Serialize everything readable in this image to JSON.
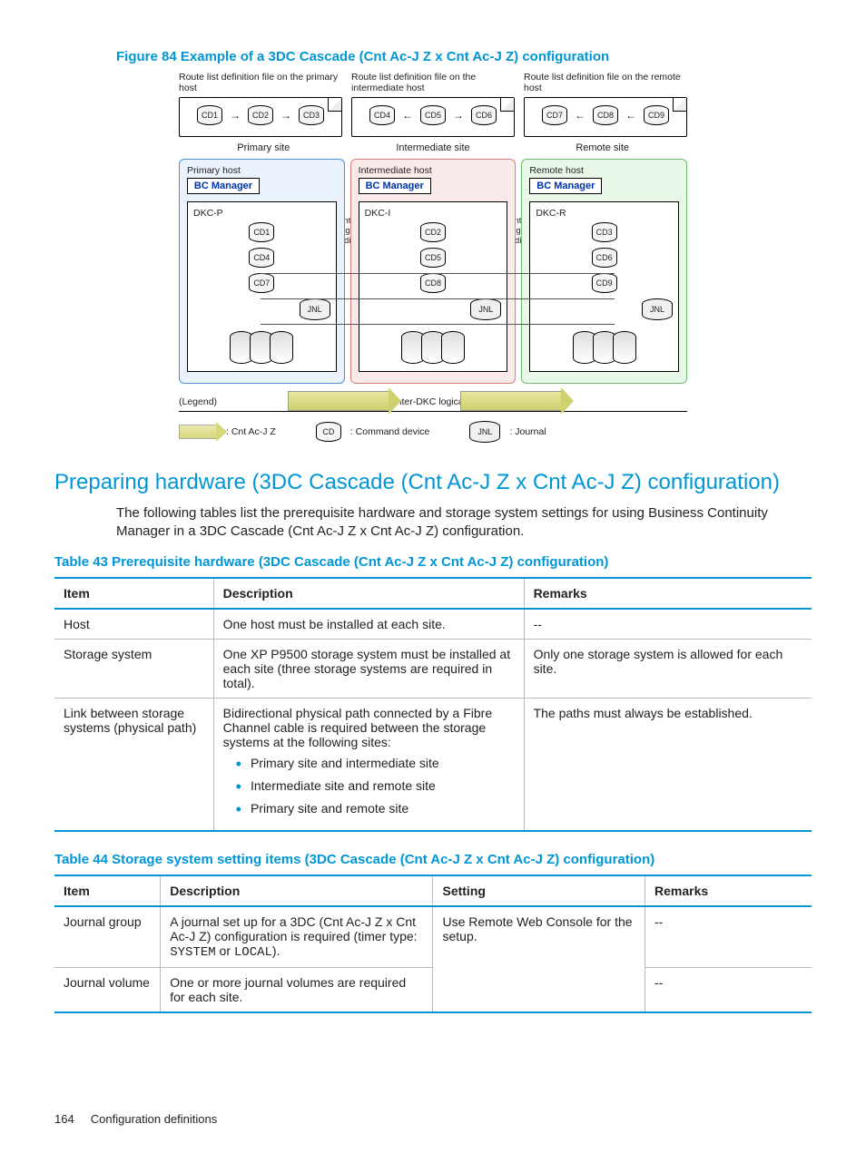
{
  "figure": {
    "title": "Figure 84 Example of a 3DC Cascade (Cnt Ac-J Z x Cnt Ac-J Z) configuration",
    "files": [
      {
        "label": "Route list definition file on the primary host",
        "cds": [
          "CD1",
          "CD2",
          "CD3"
        ],
        "dir": "right"
      },
      {
        "label": "Route list definition file on the intermediate host",
        "cds": [
          "CD4",
          "CD5",
          "CD6"
        ],
        "dir": "left"
      },
      {
        "label": "Route list definition file on the remote host",
        "cds": [
          "CD7",
          "CD8",
          "CD9"
        ],
        "dir": "left"
      }
    ],
    "site_labels": [
      "Primary site",
      "Intermediate site",
      "Remote site"
    ],
    "sites": [
      {
        "host": "Primary host",
        "bc": "BC Manager",
        "dkc": "DKC-P",
        "cds": [
          "CD1",
          "CD4",
          "CD7"
        ],
        "jnl": "JNL"
      },
      {
        "host": "Intermediate host",
        "bc": "BC Manager",
        "dkc": "DKC-I",
        "cds": [
          "CD2",
          "CD5",
          "CD8"
        ],
        "jnl": "JNL"
      },
      {
        "host": "Remote host",
        "bc": "BC Manager",
        "dkc": "DKC-R",
        "cds": [
          "CD3",
          "CD6",
          "CD9"
        ],
        "jnl": "JNL"
      }
    ],
    "inter_dkc_label": "Inter-DKC logical path (bidirectional)",
    "legend_label": "(Legend)",
    "legend_line_text": "Inter-DKC logical path (bidirectional)",
    "legend_items": [
      {
        "label": ": Cnt Ac-J Z"
      },
      {
        "sym": "CD",
        "label": ": Command device"
      },
      {
        "sym": "JNL",
        "label": ": Journal"
      }
    ]
  },
  "section": {
    "title": "Preparing hardware (3DC Cascade (Cnt Ac-J Z x Cnt Ac-J Z) configuration)",
    "body": "The following tables list the prerequisite hardware and storage system settings for using Business Continuity Manager in a 3DC Cascade (Cnt Ac-J Z x Cnt Ac-J Z) configuration."
  },
  "table43": {
    "title": "Table 43 Prerequisite hardware (3DC Cascade (Cnt Ac-J Z x Cnt Ac-J Z) configuration)",
    "headers": [
      "Item",
      "Description",
      "Remarks"
    ],
    "rows": [
      {
        "item": "Host",
        "desc": "One host must be installed at each site.",
        "remarks": "--"
      },
      {
        "item": "Storage system",
        "desc": "One XP P9500 storage system must be installed at each site (three storage systems are required in total).",
        "remarks": "Only one storage system is allowed for each site."
      },
      {
        "item": "Link between storage systems (physical path)",
        "desc": "Bidirectional physical path connected by a Fibre Channel cable is required between the storage systems at the following sites:",
        "bullets": [
          "Primary site and intermediate site",
          "Intermediate site and remote site",
          "Primary site and remote site"
        ],
        "remarks": "The paths must always be established."
      }
    ]
  },
  "table44": {
    "title": "Table 44  Storage system setting items (3DC Cascade (Cnt Ac-J Z x Cnt Ac-J Z) configuration)",
    "headers": [
      "Item",
      "Description",
      "Setting",
      "Remarks"
    ],
    "rows": [
      {
        "item": "Journal group",
        "desc_pre": "A journal set up for a 3DC (Cnt Ac-J Z x Cnt Ac-J Z) configuration is required (timer type: ",
        "desc_code1": "SYSTEM",
        "desc_mid": " or ",
        "desc_code2": "LOCAL",
        "desc_post": ").",
        "setting": "Use Remote Web Console for the setup.",
        "remarks": "--"
      },
      {
        "item": "Journal volume",
        "desc": "One or more journal volumes are required for each site.",
        "setting": "",
        "remarks": "--"
      }
    ]
  },
  "footer": {
    "page": "164",
    "section": "Configuration definitions"
  }
}
